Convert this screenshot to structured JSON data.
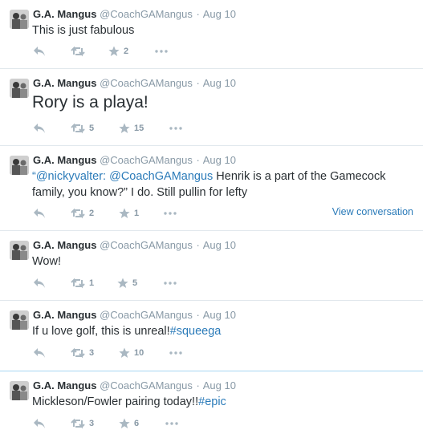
{
  "author": {
    "name": "G.A. Mangus",
    "handle": "@CoachGAMangus",
    "separator": "·"
  },
  "tweets": [
    {
      "date": "Aug 10",
      "text": "This is just fabulous",
      "retweets": "",
      "favorites": "2"
    },
    {
      "date": "Aug 10",
      "text": "Rory is a playa!",
      "retweets": "5",
      "favorites": "15"
    },
    {
      "date": "Aug 10",
      "mention1": "“@nickyvalter:",
      "mention2": "@CoachGAMangus",
      "text_rest": " Henrik is a part of the Gamecock family, you know?” I do. Still pullin for lefty",
      "retweets": "2",
      "favorites": "1",
      "view_conversation": "View conversation"
    },
    {
      "date": "Aug 10",
      "text": "Wow!",
      "retweets": "1",
      "favorites": "5"
    },
    {
      "date": "Aug 10",
      "text": "If u love golf, this is unreal!",
      "hashtag": "#squeega",
      "retweets": "3",
      "favorites": "10"
    },
    {
      "date": "Aug 10",
      "text": "Mickleson/Fowler pairing today!!",
      "hashtag": "#epic",
      "retweets": "3",
      "favorites": "6"
    }
  ],
  "icons": {
    "reply": "reply-icon",
    "retweet": "retweet-icon",
    "favorite": "star-icon",
    "more": "more-icon"
  },
  "colors": {
    "link": "#2b7bb9",
    "meta": "#8899a6",
    "icon": "#aab8c2",
    "divider": "#e1e8ed"
  }
}
